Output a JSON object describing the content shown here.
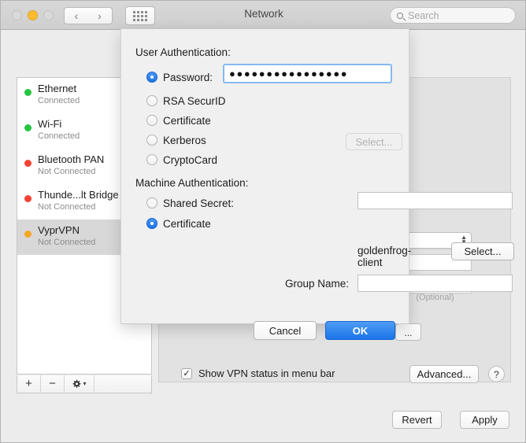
{
  "window": {
    "title": "Network",
    "traffic_lights": [
      "close",
      "minimize",
      "zoom"
    ],
    "nav_back_icon": "chevron-left-icon",
    "nav_forward_icon": "chevron-right-icon",
    "grid_icon": "grid-of-dots-icon"
  },
  "search": {
    "placeholder": "Search",
    "value": "",
    "icon": "search-icon"
  },
  "sidebar": {
    "services": [
      {
        "name": "Ethernet",
        "status": "Connected",
        "dot_color": "#26c441",
        "selected": false
      },
      {
        "name": "Wi-Fi",
        "status": "Connected",
        "dot_color": "#26c441",
        "selected": false
      },
      {
        "name": "Bluetooth PAN",
        "status": "Not Connected",
        "dot_color": "#f34235",
        "selected": false
      },
      {
        "name": "Thunde...lt Bridge",
        "status": "Not Connected",
        "dot_color": "#f34235",
        "selected": false
      },
      {
        "name": "VyprVPN",
        "status": "Not Connected",
        "dot_color": "#f5a623",
        "selected": true
      }
    ],
    "toolbar": {
      "add_label": "+",
      "remove_label": "−",
      "actions_icon": "gear-icon",
      "actions_chevron": "▾"
    }
  },
  "background_panel": {
    "popup_stepper_icon": "stepper-arrows-icon",
    "ellipsis_button_label": "...",
    "vpn_status_checkbox": {
      "label": "Show VPN status in menu bar",
      "checked": true,
      "check_glyph": "✓"
    },
    "advanced_button": "Advanced...",
    "help_button": "?"
  },
  "bottom_buttons": {
    "revert": "Revert",
    "apply": "Apply"
  },
  "sheet": {
    "user_auth": {
      "title": "User Authentication:",
      "options": [
        {
          "label": "Password:",
          "selected": true
        },
        {
          "label": "RSA SecurID",
          "selected": false
        },
        {
          "label": "Certificate",
          "selected": false
        },
        {
          "label": "Kerberos",
          "selected": false
        },
        {
          "label": "CryptoCard",
          "selected": false
        }
      ],
      "password_value": "●●●●●●●●●●●●●●●●",
      "password_placeholder": "",
      "certificate_select_button": "Select..."
    },
    "machine_auth": {
      "title": "Machine Authentication:",
      "options": [
        {
          "label": "Shared Secret:",
          "selected": false
        },
        {
          "label": "Certificate",
          "selected": true
        }
      ],
      "shared_secret_value": "",
      "certificate_name": "goldenfrog-client",
      "certificate_select_button": "Select...",
      "group_name_label": "Group Name:",
      "group_name_value": "",
      "group_name_hint": "(Optional)"
    },
    "buttons": {
      "cancel": "Cancel",
      "ok": "OK"
    }
  },
  "colors": {
    "accent_blue": "#1a74e8",
    "status_green": "#26c441",
    "status_red": "#f34235",
    "status_amber": "#f5a623",
    "window_bg": "#ececec",
    "panel_bg": "#e2e2e2",
    "sheet_bg": "#f0f0f0"
  }
}
